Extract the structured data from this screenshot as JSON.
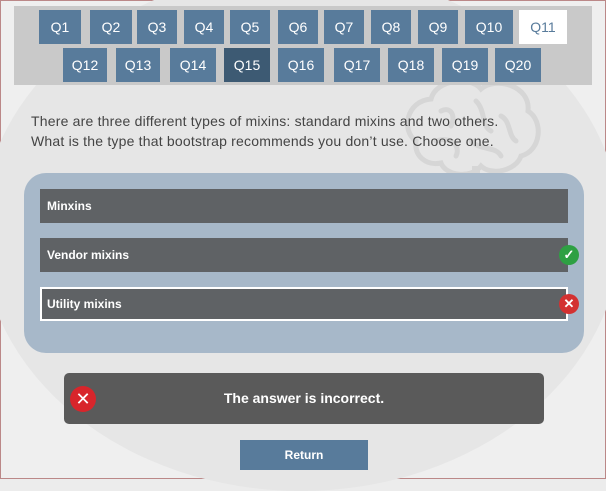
{
  "nav": {
    "row1": [
      "Q1",
      "Q2",
      "Q3",
      "Q4",
      "Q5",
      "Q6",
      "Q7",
      "Q8",
      "Q9",
      "Q10",
      "Q11"
    ],
    "row2": [
      "Q12",
      "Q13",
      "Q14",
      "Q15",
      "Q16",
      "Q17",
      "Q18",
      "Q19",
      "Q20"
    ],
    "active": "Q15",
    "current": "Q11"
  },
  "question": {
    "line1": "There are three different types of mixins: standard mixins and two others.",
    "line2": "What is the type that bootstrap recommends you don’t use. Choose one."
  },
  "options": [
    {
      "label": "Minxins",
      "status": "none"
    },
    {
      "label": "Vendor mixins",
      "status": "correct",
      "icon": "check-icon"
    },
    {
      "label": "Utility mixins",
      "status": "incorrect",
      "selected": true,
      "icon": "x-icon"
    }
  ],
  "result": {
    "text": "The answer is incorrect.",
    "icon": "x-circle-icon"
  },
  "return_label": "Return",
  "colors": {
    "accent": "#587b9b",
    "accent_dark": "#3d5a73",
    "panel": "#a7b8c9",
    "option_bg": "#5f6265",
    "correct": "#2ea043",
    "incorrect": "#d33131"
  }
}
